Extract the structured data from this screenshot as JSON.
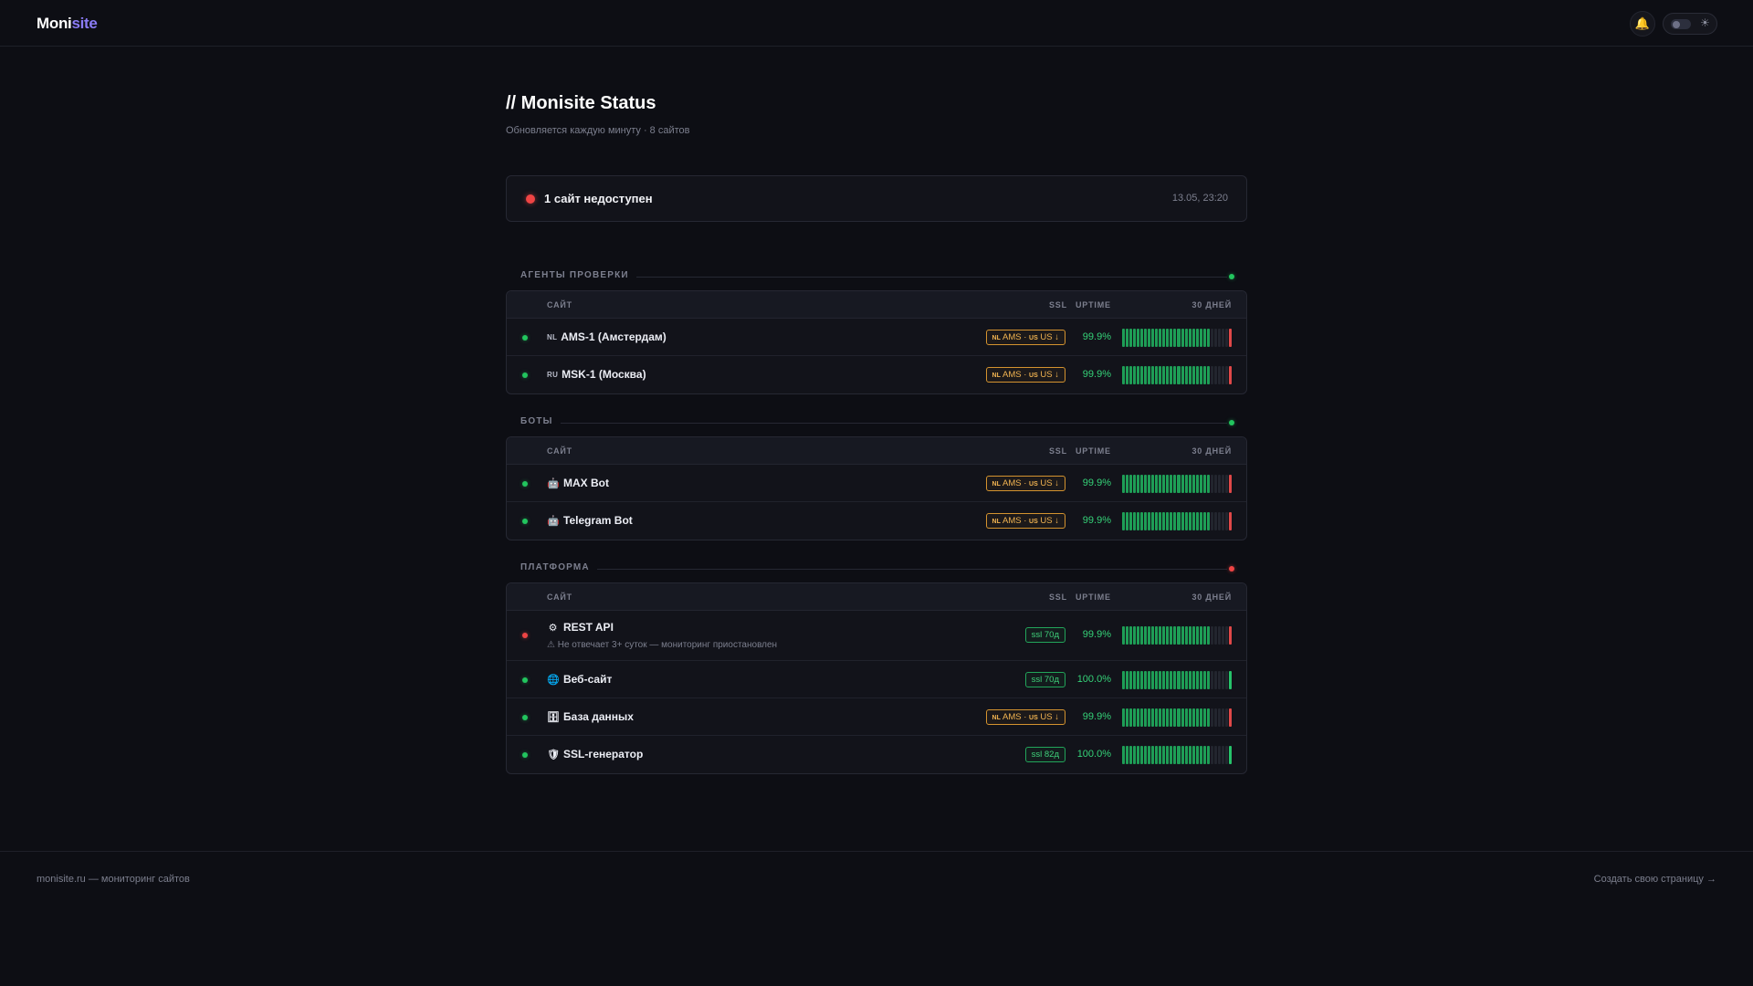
{
  "header": {
    "logo_a": "Moni",
    "logo_b": "site",
    "bell_icon": "bell-icon",
    "theme_icon": "sun-icon"
  },
  "page": {
    "title": "// Monisite Status",
    "subtitle": "Обновляется каждую минуту · 8 сайтов"
  },
  "alert": {
    "text": "1 сайт недоступен",
    "time": "13.05, 23:20"
  },
  "columns": {
    "site": "САЙТ",
    "ssl": "SSL",
    "uptime": "UPTIME",
    "days": "30 ДНЕЙ"
  },
  "groups": [
    {
      "label": "АГЕНТЫ ПРОВЕРКИ",
      "status": "ok",
      "rows": [
        {
          "flag": "NL",
          "name": "AMS-1 (Амстердам)",
          "ssl_nl": "NL",
          "ssl_mid": "AMS ·",
          "ssl_us": "US",
          "ssl_end": "US ↓",
          "uptime": "99.9%",
          "status": "ok",
          "last": "down"
        },
        {
          "flag": "RU",
          "name": "MSK-1 (Москва)",
          "ssl_nl": "NL",
          "ssl_mid": "AMS ·",
          "ssl_us": "US",
          "ssl_end": "US ↓",
          "uptime": "99.9%",
          "status": "ok",
          "last": "down"
        }
      ]
    },
    {
      "label": "БОТЫ",
      "status": "ok",
      "rows": [
        {
          "icon": "🤖",
          "name": "MAX Bot",
          "ssl_nl": "NL",
          "ssl_mid": "AMS ·",
          "ssl_us": "US",
          "ssl_end": "US ↓",
          "uptime": "99.9%",
          "status": "ok",
          "last": "down"
        },
        {
          "icon": "🤖",
          "name": "Telegram Bot",
          "ssl_nl": "NL",
          "ssl_mid": "AMS ·",
          "ssl_us": "US",
          "ssl_end": "US ↓",
          "uptime": "99.9%",
          "status": "ok",
          "last": "down"
        }
      ]
    },
    {
      "label": "ПЛАТФОРМА",
      "status": "bad",
      "rows": [
        {
          "icon": "⚙️",
          "name": "REST API",
          "note": "⚠ Не отвечает 3+ суток — мониторинг приостановлен",
          "ssl": "ssl 70д",
          "uptime": "99.9%",
          "status": "bad",
          "last": "down"
        },
        {
          "icon": "🌐",
          "name": "Веб-сайт",
          "ssl": "ssl 70д",
          "uptime": "100.0%",
          "status": "ok",
          "last": "up"
        },
        {
          "icon": "🗄️",
          "name": "База данных",
          "ssl_nl": "NL",
          "ssl_mid": "AMS ·",
          "ssl_us": "US",
          "ssl_end": "US ↓",
          "uptime": "99.9%",
          "status": "ok",
          "last": "down"
        },
        {
          "icon": "🛡️",
          "name": "SSL-генератор",
          "ssl": "ssl 82д",
          "uptime": "100.0%",
          "status": "ok",
          "last": "up"
        }
      ]
    }
  ],
  "footer": {
    "left": "monisite.ru — мониторинг сайтов",
    "right": "Создать свою страницу →"
  },
  "colors": {
    "ok": "#22c55e",
    "bad": "#ef4444",
    "warn": "#f2b451",
    "accent": "#8b7cf6"
  }
}
